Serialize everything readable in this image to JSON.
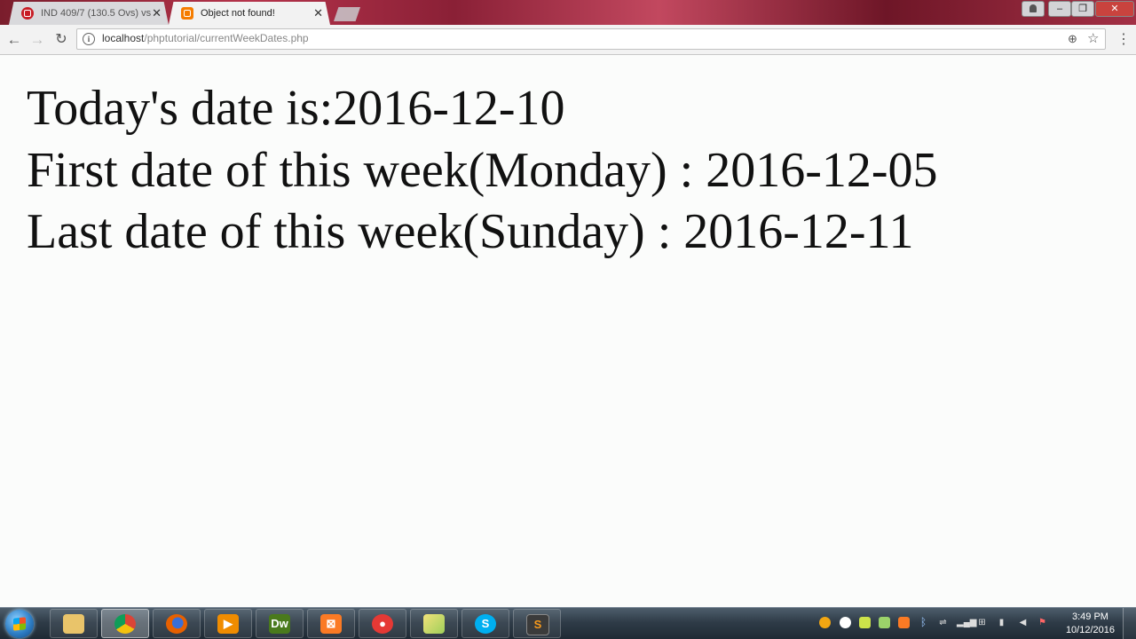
{
  "browser": {
    "tabs": [
      {
        "title": "IND 409/7 (130.5 Ovs) vs",
        "active": false,
        "icon": "cricinfo-icon"
      },
      {
        "title": "Object not found!",
        "active": true,
        "icon": "xampp-icon"
      }
    ],
    "close_glyph": "✕",
    "address": {
      "host": "localhost",
      "path": "/phptutorial/currentWeekDates.php"
    },
    "icons": {
      "back": "←",
      "forward": "→",
      "reload": "↻",
      "zoom": "⊕",
      "star": "☆",
      "menu": "⋮",
      "info": "i"
    },
    "window_controls": {
      "minimize": "‒",
      "restore": "❐",
      "close": "✕"
    }
  },
  "page": {
    "lines": [
      "Today's date is:2016-12-10",
      "First date of this week(Monday) : 2016-12-05",
      "Last date of this week(Sunday) : 2016-12-11"
    ]
  },
  "taskbar": {
    "apps": [
      {
        "name": "file-explorer",
        "glyph": "",
        "color": "#e9c46a"
      },
      {
        "name": "chrome",
        "glyph": "",
        "color": "#d93025"
      },
      {
        "name": "firefox",
        "glyph": "",
        "color": "#e66000"
      },
      {
        "name": "media-player",
        "glyph": "",
        "color": "#f08c00"
      },
      {
        "name": "dreamweaver",
        "glyph": "Dw",
        "color": "#4a7a1c"
      },
      {
        "name": "xampp",
        "glyph": "⊠",
        "color": "#fb7a24"
      },
      {
        "name": "camera-app",
        "glyph": "●",
        "color": "#e53935"
      },
      {
        "name": "folder-app",
        "glyph": "",
        "color": "#d4c34a"
      },
      {
        "name": "skype",
        "glyph": "S",
        "color": "#00aff0"
      },
      {
        "name": "sublime-text",
        "glyph": "S",
        "color": "#3b3b3b"
      }
    ],
    "clock": {
      "time": "3:49 PM",
      "date": "10/12/2016"
    }
  }
}
